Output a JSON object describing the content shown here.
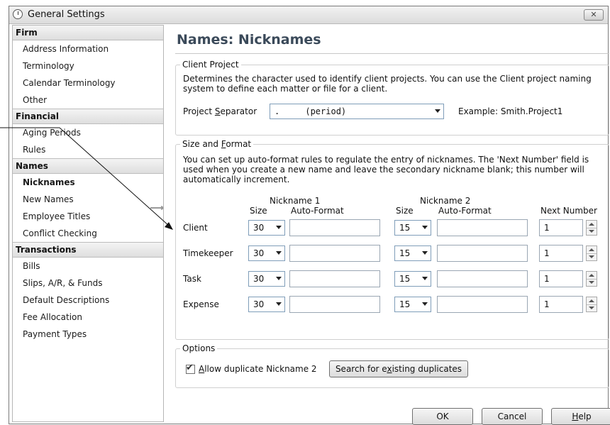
{
  "window": {
    "title": "General Settings",
    "close_glyph": "✕"
  },
  "sidebar": {
    "sections": [
      {
        "header": "Firm",
        "items": [
          "Address Information",
          "Terminology",
          "Calendar Terminology",
          "Other"
        ]
      },
      {
        "header": "Financial",
        "items": [
          "Aging Periods",
          "Rules"
        ]
      },
      {
        "header": "Names",
        "items": [
          "Nicknames",
          "New Names",
          "Employee Titles",
          "Conflict Checking"
        ]
      },
      {
        "header": "Transactions",
        "items": [
          "Bills",
          "Slips, A/R, & Funds",
          "Default Descriptions",
          "Fee Allocation",
          "Payment Types"
        ]
      }
    ],
    "selected": "Nicknames"
  },
  "page": {
    "title": "Names: Nicknames"
  },
  "client_project": {
    "legend": "Client Project",
    "description_line1": "Determines the character used to identify client projects. You can use the Client project naming",
    "description_line2": "system to define each matter or file for a client.",
    "separator_label_pre": "Project ",
    "separator_label_u": "S",
    "separator_label_post": "eparator",
    "separator_value": ".     (period)",
    "example": "Example: Smith.Project1"
  },
  "size_format": {
    "legend_pre": "Size and ",
    "legend_u": "F",
    "legend_post": "ormat",
    "description_line1": "You can set up auto-format rules to regulate the entry of nicknames. The 'Next Number' field is",
    "description_line2": "used when you create a new name and leave the secondary nickname blank; this number will",
    "description_line3": "automatically increment.",
    "nickname1_header": "Nickname 1",
    "nickname2_header": "Nickname 2",
    "size_header": "Size",
    "autoformat_header": "Auto-Format",
    "next_number_header": "Next Number",
    "rows": [
      {
        "label": "Client",
        "size1": "30",
        "size2": "15",
        "next": "1"
      },
      {
        "label": "Timekeeper",
        "size1": "30",
        "size2": "15",
        "next": "1"
      },
      {
        "label": "Task",
        "size1": "30",
        "size2": "15",
        "next": "1"
      },
      {
        "label": "Expense",
        "size1": "30",
        "size2": "15",
        "next": "1"
      }
    ]
  },
  "options": {
    "legend": "Options",
    "allow_dup_pre": "",
    "allow_dup_u": "A",
    "allow_dup_post": "llow duplicate Nickname 2",
    "allow_dup_checked": true,
    "search_pre": "Search for e",
    "search_u": "x",
    "search_post": "isting duplicates"
  },
  "buttons": {
    "ok": "OK",
    "cancel": "Cancel",
    "help_u": "H",
    "help_post": "elp"
  }
}
